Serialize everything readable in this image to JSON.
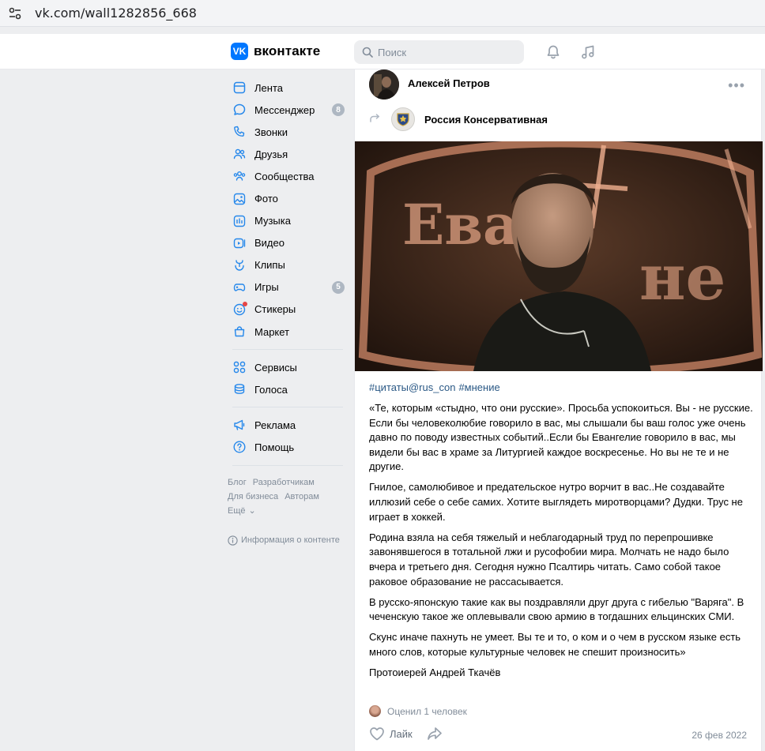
{
  "browser": {
    "url": "vk.com/wall1282856_668"
  },
  "header": {
    "logo_text": "вконтакте",
    "search_placeholder": "Поиск"
  },
  "nav": {
    "items": [
      {
        "label": "Лента",
        "icon": "feed-icon"
      },
      {
        "label": "Мессенджер",
        "icon": "messenger-icon",
        "counter": "8"
      },
      {
        "label": "Звонки",
        "icon": "phone-icon"
      },
      {
        "label": "Друзья",
        "icon": "friends-icon"
      },
      {
        "label": "Сообщества",
        "icon": "communities-icon"
      },
      {
        "label": "Фото",
        "icon": "photo-icon"
      },
      {
        "label": "Музыка",
        "icon": "music-icon"
      },
      {
        "label": "Видео",
        "icon": "video-icon"
      },
      {
        "label": "Клипы",
        "icon": "clips-icon"
      },
      {
        "label": "Игры",
        "icon": "games-icon",
        "counter": "5"
      },
      {
        "label": "Стикеры",
        "icon": "stickers-icon"
      },
      {
        "label": "Маркет",
        "icon": "market-icon"
      }
    ],
    "items2": [
      {
        "label": "Сервисы",
        "icon": "services-icon"
      },
      {
        "label": "Голоса",
        "icon": "votes-icon"
      }
    ],
    "items3": [
      {
        "label": "Реклама",
        "icon": "ads-icon"
      },
      {
        "label": "Помощь",
        "icon": "help-icon"
      }
    ],
    "footer": {
      "blog": "Блог",
      "developers": "Разработчикам",
      "business": "Для бизнеса",
      "authors": "Авторам",
      "more": "Ещё"
    },
    "content_info": "Информация о контенте"
  },
  "post": {
    "author": "Алексей Петров",
    "group": "Россия Консервативная",
    "hashtags": [
      "#цитаты@rus_con",
      "#мнение"
    ],
    "paragraphs": [
      "«Те, которым «стыдно, что они русские». Просьба успокоиться. Вы - не русские. Если бы человеколюбие говорило в вас, мы слышали бы ваш голос уже очень давно по поводу известных событий..Если бы Евангелие говорило в вас, мы видели бы вас в храме за Литургией каждое воскресенье. Но вы не те и не другие.",
      "Гнилое, самолюбивое и предательское нутро ворчит в вас..Не создавайте иллюзий себе о себе самих. Хотите выглядеть миротворцами? Дудки. Трус не играет в хоккей.",
      "Родина взяла на себя тяжелый и неблагодарный труд по перепрошивке завонявшегося в тотальной лжи и русофобии мира. Молчать не надо было вчера и третьего дня. Сегодня нужно Псалтирь читать. Само собой такое раковое образование не рассасывается.",
      "В русско-японскую такие как вы поздравляли друг друга с гибелью \"Варяга\". В чеченскую такое же оплевывали свою армию в тогдашних ельцинских СМИ.",
      "Скунс иначе пахнуть не умеет. Вы те и то, о ком и о чем в русском языке есть много слов, которые культурные человек не спешит произносить»",
      "Протоиерей Андрей Ткачёв"
    ],
    "likes_info": "Оценил 1 человек",
    "like_label": "Лайк",
    "date": "26 фев 2022"
  },
  "colors": {
    "accent": "#0077ff",
    "link": "#2a5885",
    "muted": "#818c99"
  }
}
